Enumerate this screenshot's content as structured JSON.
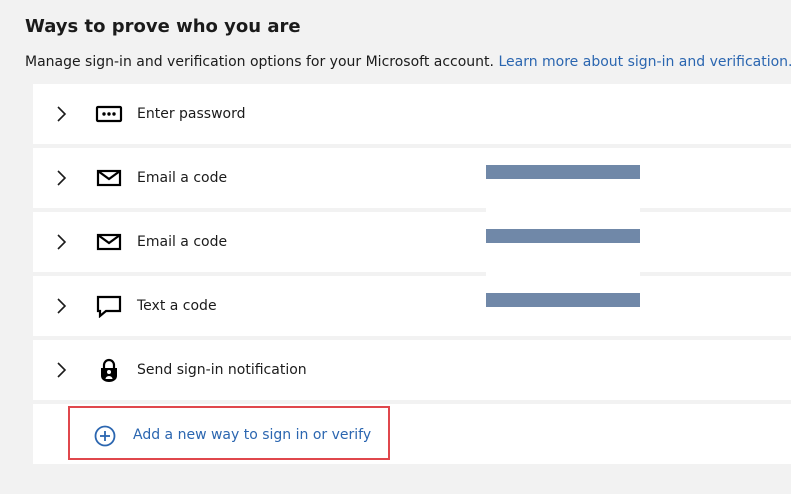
{
  "header": {
    "title": "Ways to prove who you are",
    "description": "Manage sign-in and verification options for your Microsoft account.",
    "learn_more_link": "Learn more about sign-in and verification."
  },
  "methods": [
    {
      "label": "Enter password",
      "icon": "password-dots-icon"
    },
    {
      "label": "Email a code",
      "icon": "envelope-icon"
    },
    {
      "label": "Email a code",
      "icon": "envelope-icon"
    },
    {
      "label": "Text a code",
      "icon": "chat-bubble-icon"
    },
    {
      "label": "Send sign-in notification",
      "icon": "lock-person-icon"
    }
  ],
  "add_method": {
    "label": "Add a new way to sign in or verify",
    "icon": "plus-circle-icon"
  },
  "colors": {
    "link": "#2b66b0",
    "highlight_border": "#e0474c",
    "redaction": "#7088a8",
    "page_bg": "#f2f2f2"
  }
}
